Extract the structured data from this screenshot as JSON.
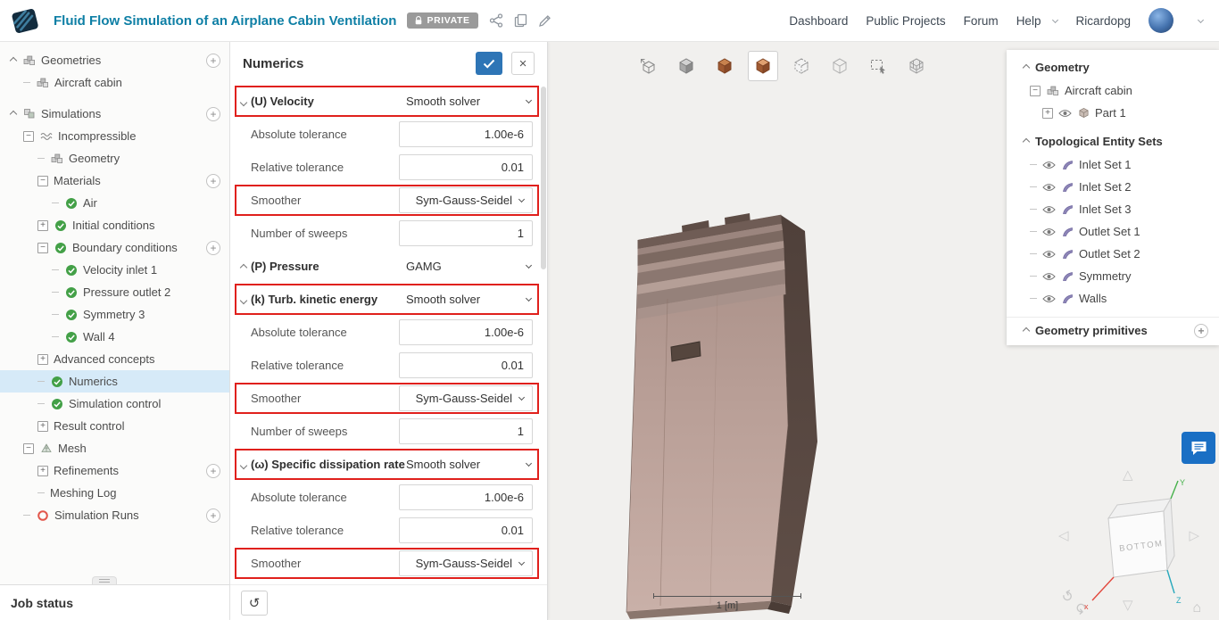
{
  "colors": {
    "title": "#0e7fa5",
    "accent": "#2e75b6",
    "highlight": "#e0201c",
    "check_green": "#43a047",
    "selected_bg": "#d6eaf8",
    "badge_gray": "#9a9a9a",
    "chat_blue": "#1a6fc4"
  },
  "glyphs": {
    "plus": "+",
    "minus": "−",
    "close": "×",
    "undo": "↺",
    "home": "⌂",
    "nav_left": "◁",
    "nav_right": "▷",
    "nav_up": "△",
    "nav_down": "▽",
    "rotate_ccw": "↺",
    "rotate_cw": "↻"
  },
  "header": {
    "title": "Fluid Flow Simulation of an Airplane Cabin Ventilation",
    "private_badge": "PRIVATE",
    "nav": [
      {
        "label": "Dashboard"
      },
      {
        "label": "Public Projects"
      },
      {
        "label": "Forum"
      },
      {
        "label": "Help",
        "caret": true
      },
      {
        "label": "Ricardopg"
      }
    ]
  },
  "sidebar": {
    "items": [
      {
        "label": "Geometries",
        "depth": 0,
        "chev": "up",
        "icon": "parts",
        "add": true
      },
      {
        "label": "Aircraft cabin",
        "depth": 1,
        "dash": true,
        "icon": "parts",
        "gap_after": true
      },
      {
        "label": "Simulations",
        "depth": 0,
        "chev": "up",
        "icon": "sim",
        "add": true
      },
      {
        "label": "Incompressible",
        "depth": 1,
        "expander": "minus",
        "icon": "wave"
      },
      {
        "label": "Geometry",
        "depth": 2,
        "dash": true,
        "icon": "parts"
      },
      {
        "label": "Materials",
        "depth": 2,
        "expander": "minus",
        "add": true
      },
      {
        "label": "Air",
        "depth": 3,
        "dash": true,
        "icon": "check"
      },
      {
        "label": "Initial conditions",
        "depth": 2,
        "expander": "plus",
        "icon": "check"
      },
      {
        "label": "Boundary conditions",
        "depth": 2,
        "expander": "minus",
        "icon": "check",
        "add": true
      },
      {
        "label": "Velocity inlet 1",
        "depth": 3,
        "dash": true,
        "icon": "check"
      },
      {
        "label": "Pressure outlet 2",
        "depth": 3,
        "dash": true,
        "icon": "check"
      },
      {
        "label": "Symmetry 3",
        "depth": 3,
        "dash": true,
        "icon": "check"
      },
      {
        "label": "Wall 4",
        "depth": 3,
        "dash": true,
        "icon": "check"
      },
      {
        "label": "Advanced concepts",
        "depth": 2,
        "expander": "plus"
      },
      {
        "label": "Numerics",
        "depth": 2,
        "dash": true,
        "icon": "check",
        "selected": true
      },
      {
        "label": "Simulation control",
        "depth": 2,
        "dash": true,
        "icon": "check"
      },
      {
        "label": "Result control",
        "depth": 2,
        "expander": "plus"
      },
      {
        "label": "Mesh",
        "depth": 1,
        "expander": "minus",
        "icon": "mesh"
      },
      {
        "label": "Refinements",
        "depth": 2,
        "expander": "plus",
        "add": true
      },
      {
        "label": "Meshing Log",
        "depth": 2,
        "dash": true
      },
      {
        "label": "Simulation Runs",
        "depth": 1,
        "dash": true,
        "icon": "runs",
        "add": true
      }
    ]
  },
  "job_status": {
    "label": "Job status"
  },
  "numerics": {
    "title": "Numerics",
    "rows": [
      {
        "label": "(U) Velocity",
        "value": "Smooth solver",
        "kind": "section",
        "chev": "down",
        "highlight": true
      },
      {
        "label": "Absolute tolerance",
        "value": "1.00e-6",
        "kind": "input"
      },
      {
        "label": "Relative tolerance",
        "value": "0.01",
        "kind": "input"
      },
      {
        "label": "Smoother",
        "value": "Sym-Gauss-Seidel",
        "kind": "select",
        "highlight": true
      },
      {
        "label": "Number of sweeps",
        "value": "1",
        "kind": "input"
      },
      {
        "label": "(P) Pressure",
        "value": "GAMG",
        "kind": "section",
        "chev": "up"
      },
      {
        "label": "(k) Turb. kinetic energy",
        "value": "Smooth solver",
        "kind": "section",
        "chev": "down",
        "highlight": true
      },
      {
        "label": "Absolute tolerance",
        "value": "1.00e-6",
        "kind": "input"
      },
      {
        "label": "Relative tolerance",
        "value": "0.01",
        "kind": "input"
      },
      {
        "label": "Smoother",
        "value": "Sym-Gauss-Seidel",
        "kind": "select",
        "highlight": true
      },
      {
        "label": "Number of sweeps",
        "value": "1",
        "kind": "input"
      },
      {
        "label": "(ω) Specific dissipation rate",
        "value": "Smooth solver",
        "kind": "section",
        "chev": "down",
        "highlight": true
      },
      {
        "label": "Absolute tolerance",
        "value": "1.00e-6",
        "kind": "input"
      },
      {
        "label": "Relative tolerance",
        "value": "0.01",
        "kind": "input"
      },
      {
        "label": "Smoother",
        "value": "Sym-Gauss-Seidel",
        "kind": "select",
        "highlight": true
      }
    ]
  },
  "viewport": {
    "toolbar": [
      {
        "name": "fit-view"
      },
      {
        "name": "shaded-view"
      },
      {
        "name": "solid-view"
      },
      {
        "name": "surface-select",
        "active": true
      },
      {
        "name": "ghost-view"
      },
      {
        "name": "wireframe-view"
      },
      {
        "name": "box-select"
      },
      {
        "name": "mesh-view"
      }
    ],
    "scale_label": "1 [m]",
    "nav_cube_label": "BOTTOM",
    "axes": {
      "x": "x",
      "y": "Y",
      "z": "Z"
    }
  },
  "scene_tree": {
    "items": [
      {
        "label": "Geometry",
        "kind": "header",
        "chev": "up"
      },
      {
        "label": "Aircraft cabin",
        "depth": 1,
        "expander": "minus",
        "icon": "parts"
      },
      {
        "label": "Part 1",
        "depth": 2,
        "expander": "plus",
        "eye": true,
        "icon": "cube"
      },
      {
        "label": "Topological Entity Sets",
        "kind": "header",
        "chev": "up",
        "gap_before": true
      },
      {
        "label": "Inlet Set 1",
        "depth": 1,
        "dash": true,
        "eye": true,
        "icon": "shell"
      },
      {
        "label": "Inlet Set 2",
        "depth": 1,
        "dash": true,
        "eye": true,
        "icon": "shell"
      },
      {
        "label": "Inlet Set 3",
        "depth": 1,
        "dash": true,
        "eye": true,
        "icon": "shell"
      },
      {
        "label": "Outlet Set 1",
        "depth": 1,
        "dash": true,
        "eye": true,
        "icon": "shell"
      },
      {
        "label": "Outlet Set 2",
        "depth": 1,
        "dash": true,
        "eye": true,
        "icon": "shell"
      },
      {
        "label": "Symmetry",
        "depth": 1,
        "dash": true,
        "eye": true,
        "icon": "shell"
      },
      {
        "label": "Walls",
        "depth": 1,
        "dash": true,
        "eye": true,
        "icon": "shell"
      },
      {
        "label": "Geometry primitives",
        "kind": "header",
        "chev": "up",
        "add": true,
        "divider": true
      }
    ]
  }
}
